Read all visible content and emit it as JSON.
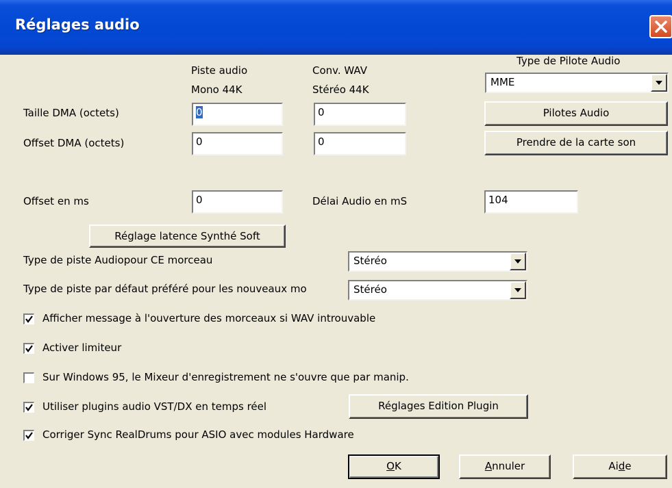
{
  "window": {
    "title": "Réglages audio"
  },
  "headers": {
    "col1_line1": "Piste audio",
    "col1_line2": "Mono 44K",
    "col2_line1": "Conv. WAV",
    "col2_line2": "Stéréo 44K",
    "driver_type": "Type de Pilote Audio"
  },
  "rows": {
    "dma_size_label": "Taille DMA (octets)",
    "dma_offset_label": "Offset DMA (octets)",
    "offset_ms_label": "Offset en ms",
    "audio_delay_label": "Délai Audio en mS"
  },
  "fields": {
    "dma_size_mono": "0",
    "dma_size_stereo": "0",
    "dma_offset_mono": "0",
    "dma_offset_stereo": "0",
    "offset_ms": "0",
    "audio_delay": "104"
  },
  "driver": {
    "selected": "MME",
    "drivers_button": "Pilotes Audio",
    "from_card_button": "Prendre de la carte son"
  },
  "latency_button": "Réglage latence Synthé Soft",
  "track_type": {
    "song_label": "Type de piste Audiopour CE morceau",
    "song_value": "Stéréo",
    "default_label": "Type de piste par défaut préféré pour les nouveaux mo",
    "default_value": "Stéréo"
  },
  "checkboxes": [
    {
      "label": "Afficher message à l'ouverture des morceaux si WAV introuvable",
      "checked": true
    },
    {
      "label": "Activer limiteur",
      "checked": true
    },
    {
      "label": "Sur Windows 95, le Mixeur d'enregistrement ne s'ouvre que par manip.",
      "checked": false
    },
    {
      "label": "Utiliser plugins audio VST/DX en temps réel",
      "checked": true
    },
    {
      "label": "Corriger Sync RealDrums pour ASIO avec modules Hardware",
      "checked": true
    }
  ],
  "plugin_button": "Réglages Edition Plugin",
  "footer": {
    "ok": {
      "mnemonic": "O",
      "rest": "K"
    },
    "cancel": {
      "mnemonic": "A",
      "rest": "nnuler"
    },
    "help": {
      "pre": "Ai",
      "mnemonic": "d",
      "rest": "e"
    }
  }
}
